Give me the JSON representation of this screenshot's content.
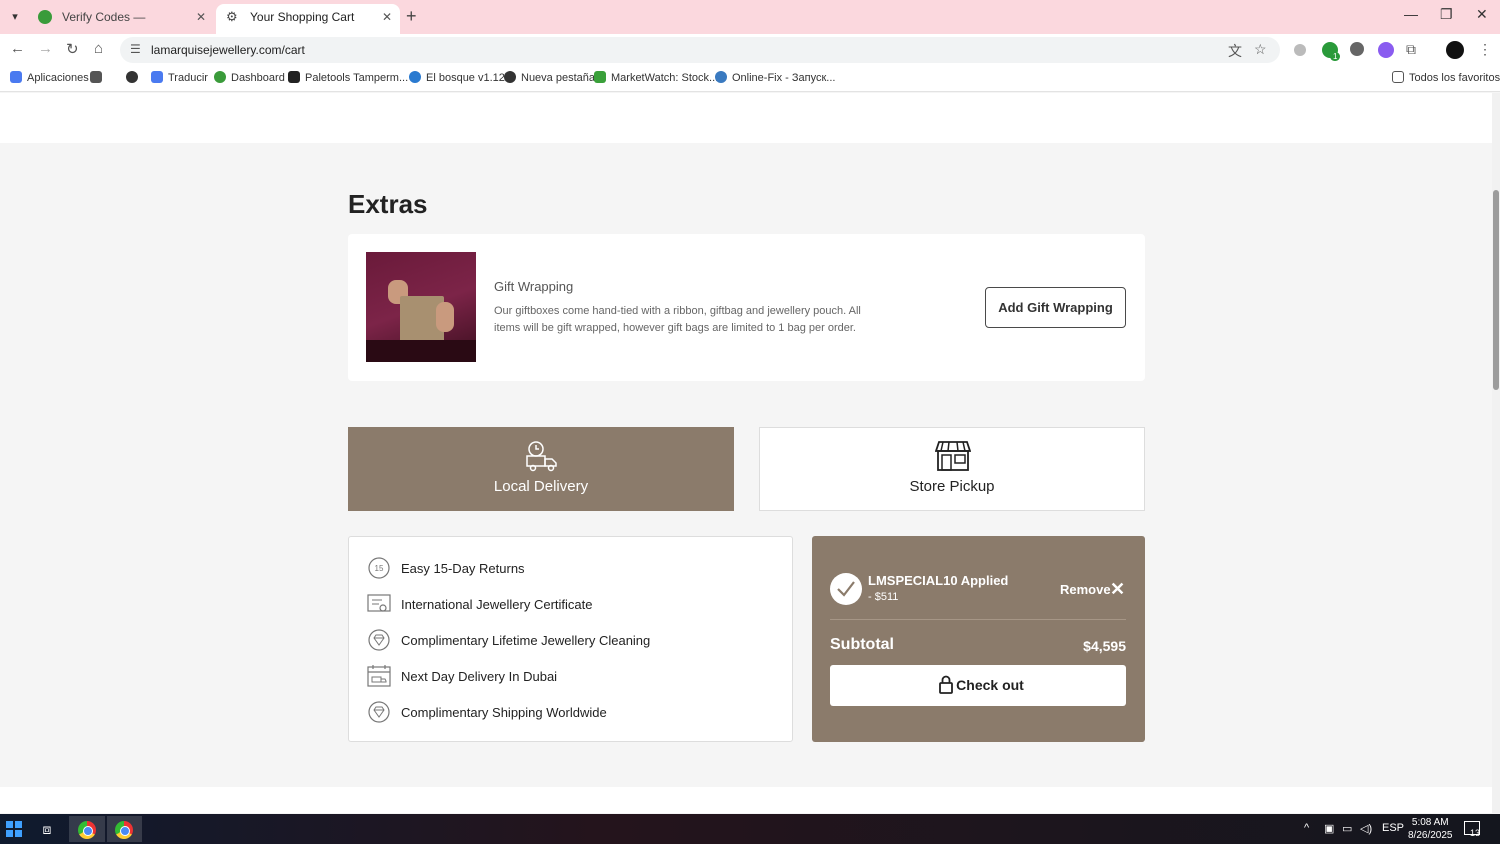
{
  "browser": {
    "tabs": [
      {
        "title": "Verify Codes — SimplyCodes",
        "active": false
      },
      {
        "title": "Your Shopping Cart",
        "active": true
      }
    ],
    "url": "lamarquisejewellery.com/cart",
    "bookmarks": [
      {
        "label": "Aplicaciones",
        "icon": "apps-grid-icon"
      },
      {
        "label": "",
        "icon": "grid-icon"
      },
      {
        "label": "",
        "icon": "globe-icon"
      },
      {
        "label": "Traducir",
        "icon": "translate-icon"
      },
      {
        "label": "Dashboard",
        "icon": "simplycodes-icon"
      },
      {
        "label": "Paletools Tamperm...",
        "icon": "tampermonkey-icon"
      },
      {
        "label": "El bosque v1.12",
        "icon": "link-icon"
      },
      {
        "label": "Nueva pestaña",
        "icon": "globe-icon"
      },
      {
        "label": "MarketWatch: Stock...",
        "icon": "marketwatch-icon"
      },
      {
        "label": "Online-Fix - Запуск...",
        "icon": "globe-icon"
      }
    ],
    "all_bookmarks": "Todos los favoritos",
    "extension_badge": "1"
  },
  "page": {
    "extras_title": "Extras",
    "gift": {
      "title": "Gift Wrapping",
      "description": "Our giftboxes come hand-tied with a ribbon, giftbag and jewellery pouch. All items will be gift wrapped, however gift bags are limited to 1 bag per order.",
      "button": "Add Gift Wrapping"
    },
    "shipping": {
      "local": "Local Delivery",
      "pickup": "Store Pickup",
      "selected": "local"
    },
    "benefits": [
      {
        "label": "Easy 15-Day Returns",
        "icon": "returns-15-icon"
      },
      {
        "label": "International Jewellery Certificate",
        "icon": "certificate-icon"
      },
      {
        "label": "Complimentary Lifetime Jewellery Cleaning",
        "icon": "diamond-cleaning-icon"
      },
      {
        "label": "Next Day Delivery In Dubai",
        "icon": "calendar-truck-icon"
      },
      {
        "label": "Complimentary Shipping Worldwide",
        "icon": "diamond-shipping-icon"
      }
    ],
    "summary": {
      "code_applied": "LMSPECIAL10 Applied",
      "discount": "- $511",
      "remove": "Remove",
      "subtotal_label": "Subtotal",
      "subtotal_value": "$4,595",
      "checkout": "Check out"
    },
    "colors": {
      "accent": "#8b7b6b",
      "tab_strip": "#fbd8de"
    }
  },
  "taskbar": {
    "language": "ESP",
    "time": "5:08 AM",
    "date": "8/26/2025",
    "notifications": "13"
  }
}
